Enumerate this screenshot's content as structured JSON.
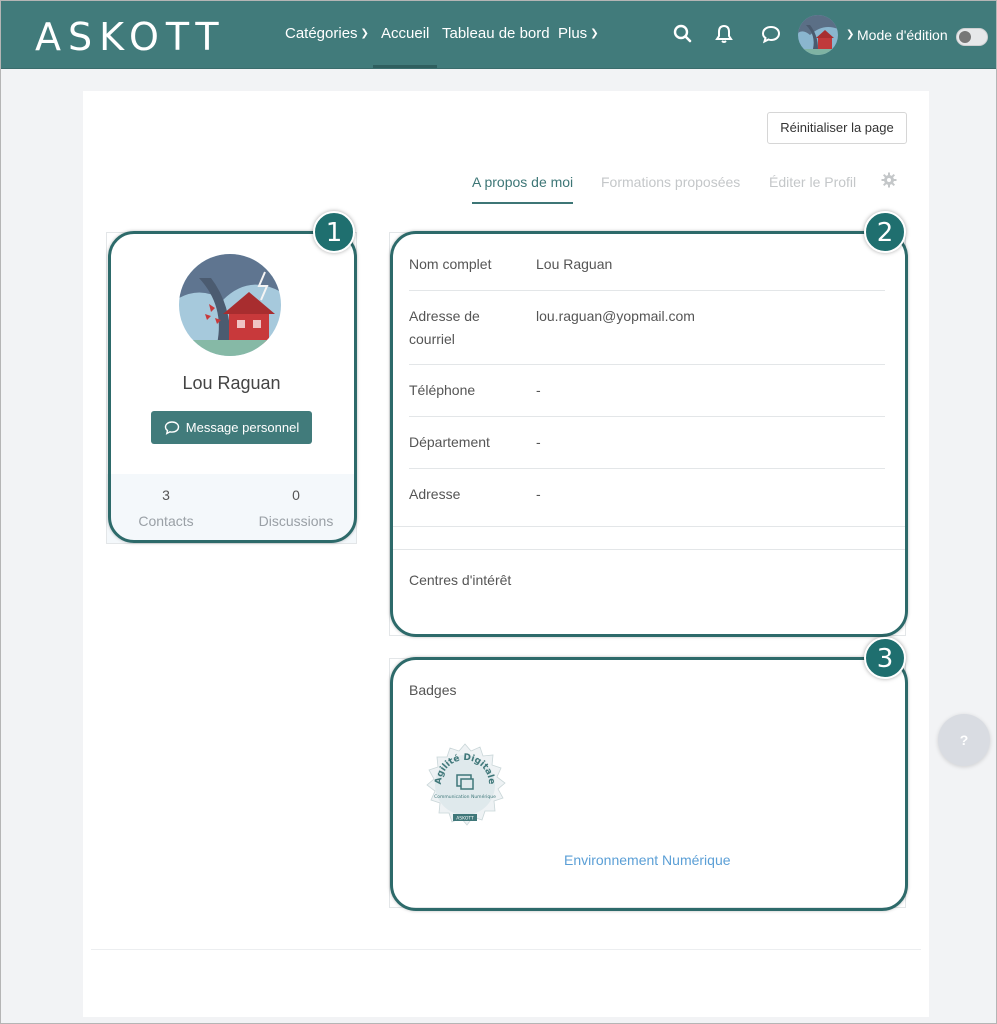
{
  "navbar": {
    "logo": "ASKOTT",
    "items": [
      {
        "label": "Catégories",
        "dropdown": true
      },
      {
        "label": "Accueil",
        "dropdown": false,
        "active": true
      },
      {
        "label": "Tableau de bord",
        "dropdown": false
      },
      {
        "label": "Plus",
        "dropdown": true
      }
    ],
    "icons": [
      "search-icon",
      "bell-icon",
      "chat-icon"
    ],
    "edit_mode_label": "Mode d'édition",
    "edit_mode_on": false
  },
  "page": {
    "reset_button": "Réinitialiser la page",
    "tabs": [
      {
        "label": "A propos de moi",
        "active": true
      },
      {
        "label": "Formations proposées",
        "active": false
      },
      {
        "label": "Éditer le Profil",
        "active": false
      }
    ]
  },
  "profile": {
    "name": "Lou Raguan",
    "message_button": "Message personnel",
    "stats": [
      {
        "value": "3",
        "label": "Contacts"
      },
      {
        "value": "0",
        "label": "Discussions"
      }
    ]
  },
  "details": {
    "rows": [
      {
        "label": "Nom complet",
        "value": "Lou Raguan"
      },
      {
        "label": "Adresse de courriel",
        "value": "lou.raguan@yopmail.com"
      },
      {
        "label": "Téléphone",
        "value": "-"
      },
      {
        "label": "Département",
        "value": "-"
      },
      {
        "label": "Adresse",
        "value": "-"
      }
    ],
    "interests_label": "Centres d'intérêt"
  },
  "badges": {
    "title": "Badges",
    "badge_text_top": "Agilité Digitale",
    "badge_text_mid": "Communication Numérique",
    "badge_text_bottom": "ASKOTT",
    "link": "Environnement Numérique"
  },
  "callouts": [
    "1",
    "2",
    "3"
  ],
  "help_label": "?",
  "colors": {
    "brand": "#417b7b",
    "callout": "#1f6f6f",
    "link": "#5b9fd6"
  }
}
